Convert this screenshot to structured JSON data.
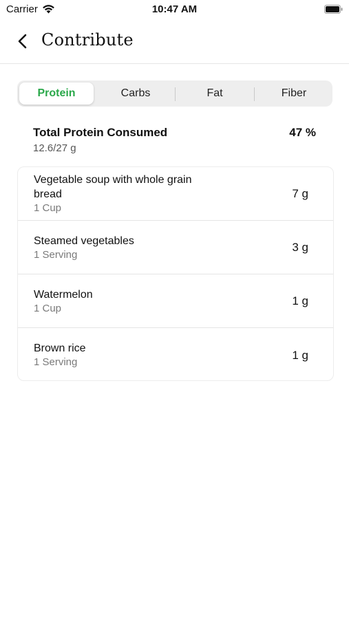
{
  "status_bar": {
    "carrier": "Carrier",
    "time": "10:47 AM"
  },
  "nav": {
    "title": "Contribute",
    "back_icon": "chevron-left-icon"
  },
  "tabs": [
    {
      "label": "Protein",
      "active": true
    },
    {
      "label": "Carbs",
      "active": false
    },
    {
      "label": "Fat",
      "active": false
    },
    {
      "label": "Fiber",
      "active": false
    }
  ],
  "summary": {
    "title": "Total Protein Consumed",
    "subtitle": "12.6/27 g",
    "percent": "47 %"
  },
  "items": [
    {
      "name": "Vegetable soup with whole grain bread",
      "serving": "1 Cup",
      "amount": "7 g"
    },
    {
      "name": "Steamed vegetables",
      "serving": "1 Serving",
      "amount": "3 g"
    },
    {
      "name": "Watermelon",
      "serving": "1 Cup",
      "amount": "1 g"
    },
    {
      "name": "Brown rice",
      "serving": "1 Serving",
      "amount": "1 g"
    }
  ],
  "colors": {
    "accent": "#2aa84a",
    "segment_bg": "#eeeeee",
    "secondary_text": "#7a7a7a"
  }
}
